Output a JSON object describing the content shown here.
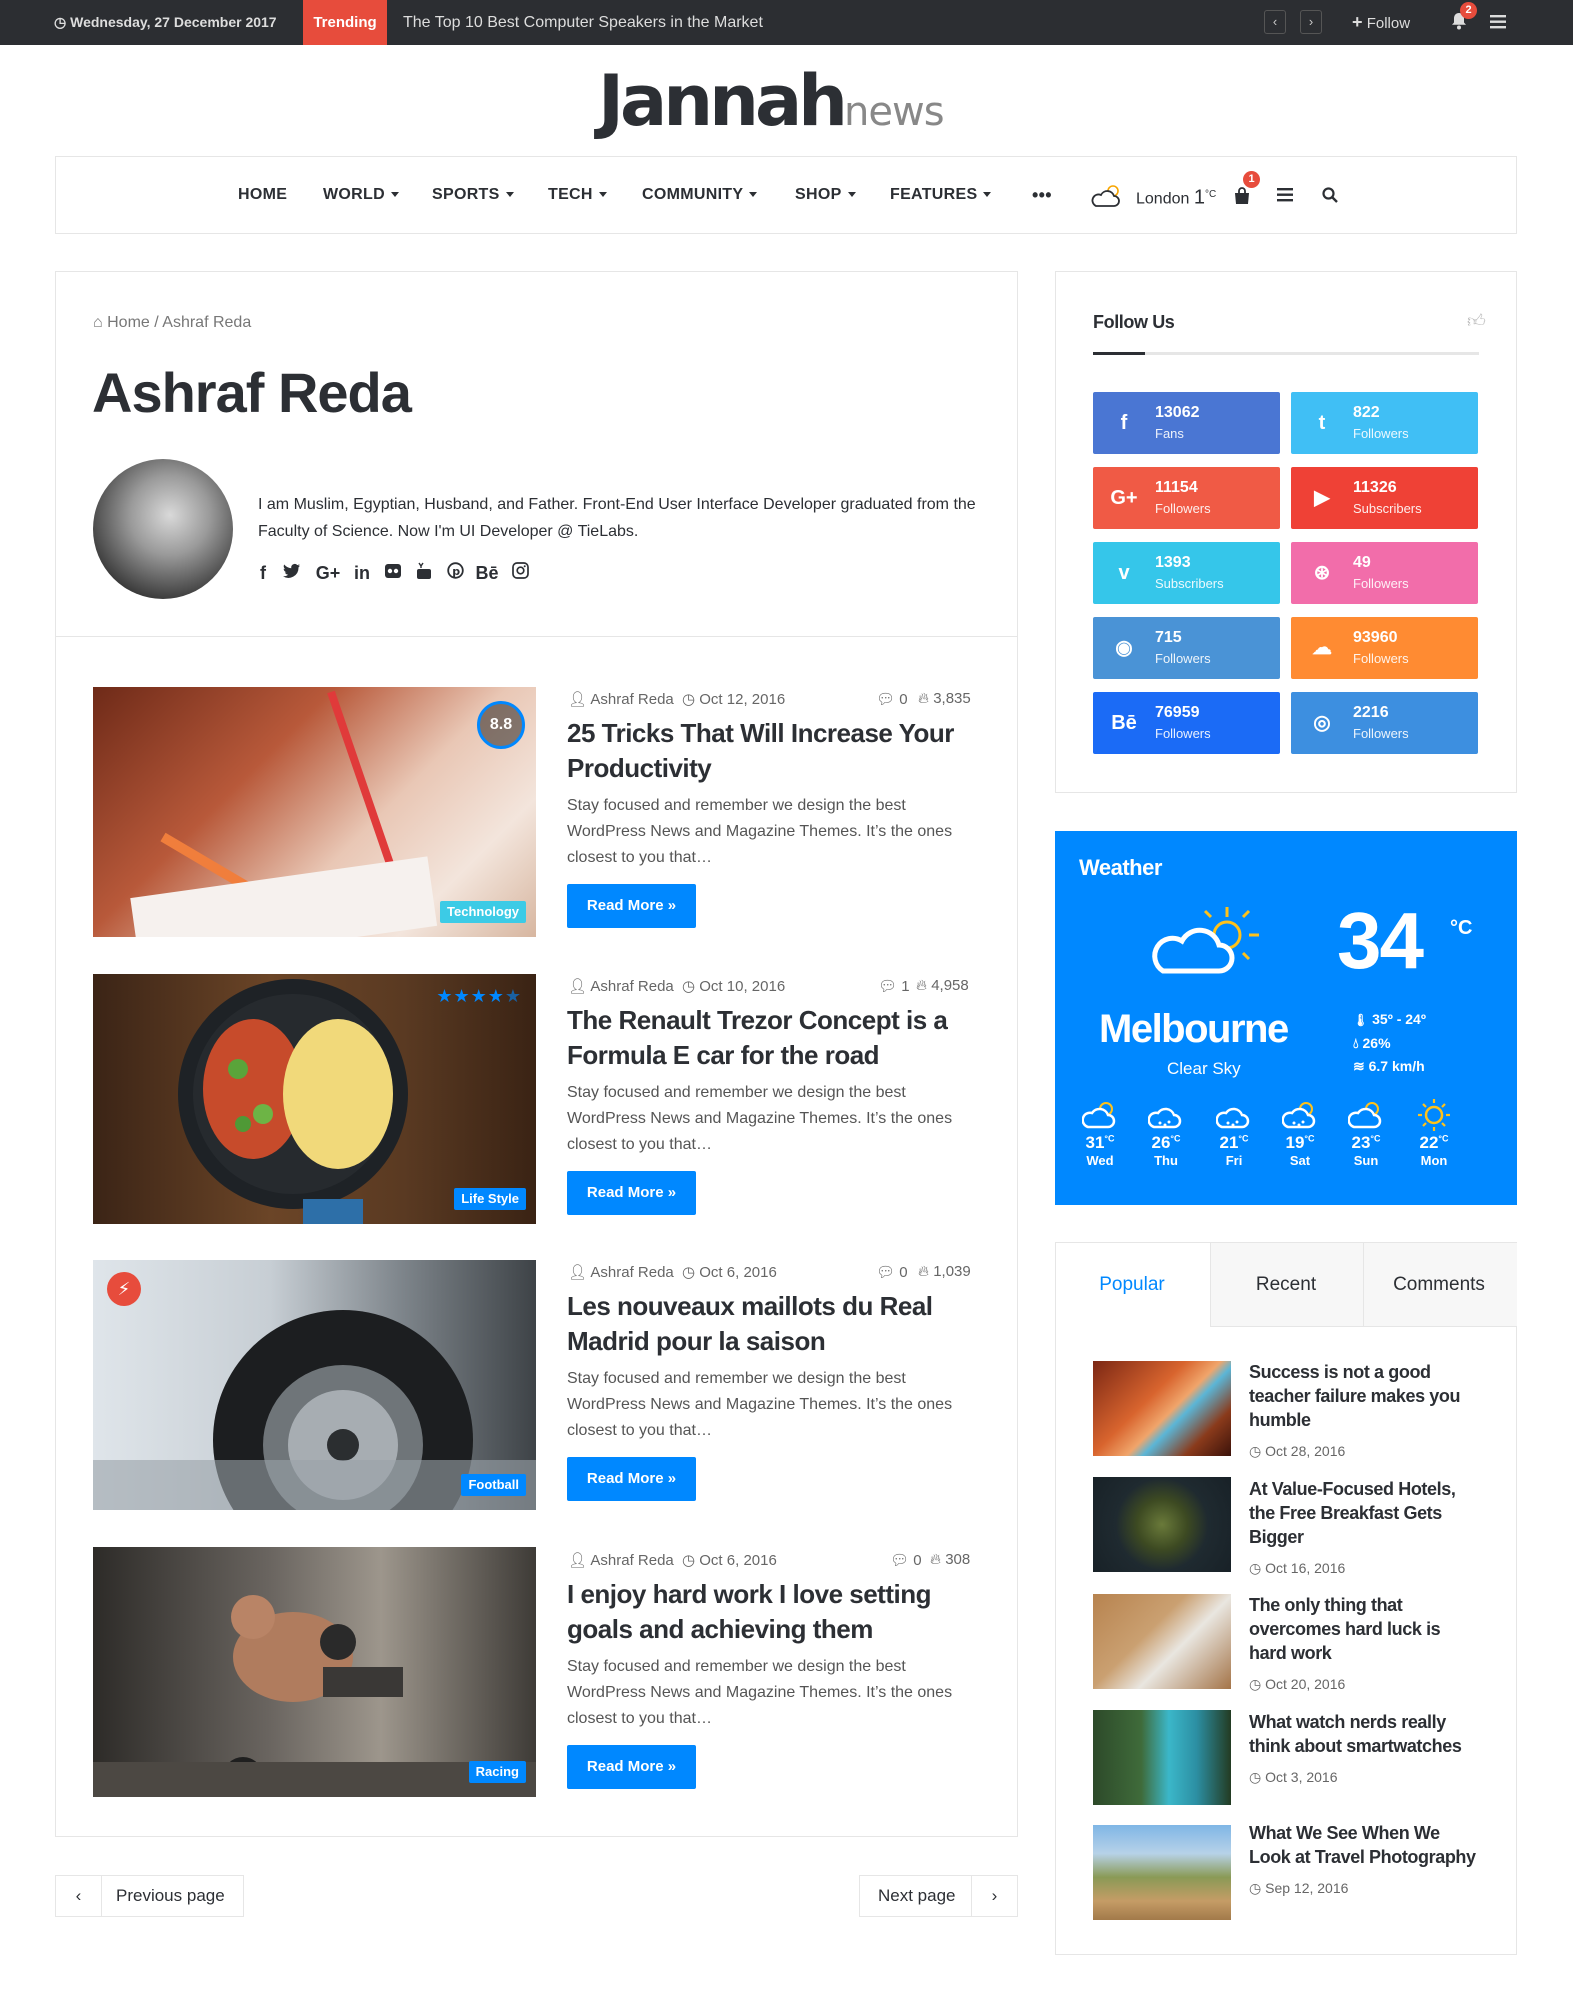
{
  "topbar": {
    "date": "Wednesday, 27 December 2017",
    "trending_label": "Trending",
    "ticker": "The Top 10 Best Computer Speakers in the Market",
    "follow_label": "Follow",
    "notifications": "2"
  },
  "logo": {
    "main": "Jannah",
    "sub": "news"
  },
  "nav": {
    "items": [
      "HOME",
      "WORLD",
      "SPORTS",
      "TECH",
      "COMMUNITY",
      "SHOP",
      "FEATURES"
    ],
    "more": "•••",
    "weather_city": "London",
    "weather_temp": "1",
    "weather_unit": "°C",
    "cart_count": "1"
  },
  "author": {
    "breadcrumb_home": "Home",
    "breadcrumb_sep": "/",
    "breadcrumb_current": "Ashraf Reda",
    "name": "Ashraf Reda",
    "bio": "I am Muslim, Egyptian, Husband, and Father. Front-End User Interface Developer graduated from the Faculty of Science. Now I'm UI Developer @ TieLabs.",
    "social_icons": [
      "facebook-icon",
      "twitter-icon",
      "google-plus-icon",
      "linkedin-icon",
      "flickr-icon",
      "youtube-icon",
      "pinterest-icon",
      "behance-icon",
      "instagram-icon"
    ]
  },
  "posts": [
    {
      "author": "Ashraf Reda",
      "date": "Oct 12, 2016",
      "comments": "0",
      "views": "3,835",
      "title": "25 Tricks That Will Increase Your Productivity",
      "excerpt": "Stay focused and remember we design the best WordPress News and Magazine Themes. It’s the ones closest to you that…",
      "read_more": "Read More »",
      "category": "Technology",
      "score": "8.8"
    },
    {
      "author": "Ashraf Reda",
      "date": "Oct 10, 2016",
      "comments": "1",
      "views": "4,958",
      "title": "The Renault Trezor Concept is a Formula E car for the road",
      "excerpt": "Stay focused and remember we design the best WordPress News and Magazine Themes. It’s the ones closest to you that…",
      "read_more": "Read More »",
      "category": "Life Style",
      "stars": 4.5
    },
    {
      "author": "Ashraf Reda",
      "date": "Oct 6, 2016",
      "comments": "0",
      "views": "1,039",
      "title": "Les nouveaux maillots du Real Madrid pour la saison",
      "excerpt": "Stay focused and remember we design the best WordPress News and Magazine Themes. It’s the ones closest to you that…",
      "read_more": "Read More »",
      "category": "Football"
    },
    {
      "author": "Ashraf Reda",
      "date": "Oct 6, 2016",
      "comments": "0",
      "views": "308",
      "title": "I enjoy hard work I love setting goals and achieving them",
      "excerpt": "Stay focused and remember we design the best WordPress News and Magazine Themes. It’s the ones closest to you that…",
      "read_more": "Read More »",
      "category": "Racing"
    }
  ],
  "pagination": {
    "prev": "Previous page",
    "next": "Next page"
  },
  "follow_us": {
    "title": "Follow Us",
    "items": [
      {
        "name": "facebook",
        "count": "13062",
        "label": "Fans",
        "color": "#4a76d3",
        "icon": "f"
      },
      {
        "name": "twitter",
        "count": "822",
        "label": "Followers",
        "color": "#40bff5",
        "icon": "t"
      },
      {
        "name": "google-plus",
        "count": "11154",
        "label": "Followers",
        "color": "#f05a45",
        "icon": "G+"
      },
      {
        "name": "youtube",
        "count": "11326",
        "label": "Subscribers",
        "color": "#ef4136",
        "icon": "▶"
      },
      {
        "name": "vimeo",
        "count": "1393",
        "label": "Subscribers",
        "color": "#35c6ea",
        "icon": "v"
      },
      {
        "name": "dribbble",
        "count": "49",
        "label": "Followers",
        "color": "#f26daa",
        "icon": "⊛"
      },
      {
        "name": "github",
        "count": "715",
        "label": "Followers",
        "color": "#4a93d6",
        "icon": "◉"
      },
      {
        "name": "soundcloud",
        "count": "93960",
        "label": "Followers",
        "color": "#ff8b32",
        "icon": "☁"
      },
      {
        "name": "behance",
        "count": "76959",
        "label": "Followers",
        "color": "#1b6bf6",
        "icon": "Bē"
      },
      {
        "name": "instagram",
        "count": "2216",
        "label": "Followers",
        "color": "#3d8fe0",
        "icon": "◎"
      }
    ]
  },
  "weather": {
    "title": "Weather",
    "temp": "34",
    "unit": "°C",
    "city": "Melbourne",
    "desc": "Clear Sky",
    "range": "35º - 24º",
    "humidity": "26%",
    "wind": "6.7 km/h",
    "forecast": [
      {
        "temp": "31",
        "unit": "°C",
        "day": "Wed",
        "icon": "partly-cloudy-icon"
      },
      {
        "temp": "26",
        "unit": "°C",
        "day": "Thu",
        "icon": "rain-icon"
      },
      {
        "temp": "21",
        "unit": "°C",
        "day": "Fri",
        "icon": "rain-icon"
      },
      {
        "temp": "19",
        "unit": "°C",
        "day": "Sat",
        "icon": "rain-sun-icon"
      },
      {
        "temp": "23",
        "unit": "°C",
        "day": "Sun",
        "icon": "partly-cloudy-icon"
      },
      {
        "temp": "22",
        "unit": "°C",
        "day": "Mon",
        "icon": "sun-icon"
      }
    ]
  },
  "tabs": {
    "labels": [
      "Popular",
      "Recent",
      "Comments"
    ],
    "active": "Popular",
    "items": [
      {
        "title": "Success is not a good teacher failure makes you humble",
        "date": "Oct 28, 2016"
      },
      {
        "title": "At Value-Focused Hotels, the Free Breakfast Gets Bigger",
        "date": "Oct 16, 2016"
      },
      {
        "title": "The only thing that overcomes hard luck is hard work",
        "date": "Oct 20, 2016"
      },
      {
        "title": "What watch nerds really think about smartwatches",
        "date": "Oct 3, 2016"
      },
      {
        "title": "What We See When We Look at Travel Photography",
        "date": "Sep 12, 2016"
      }
    ]
  },
  "colors": {
    "accent": "#0088ff",
    "dark": "#2c2f34",
    "red": "#e74c3c"
  }
}
